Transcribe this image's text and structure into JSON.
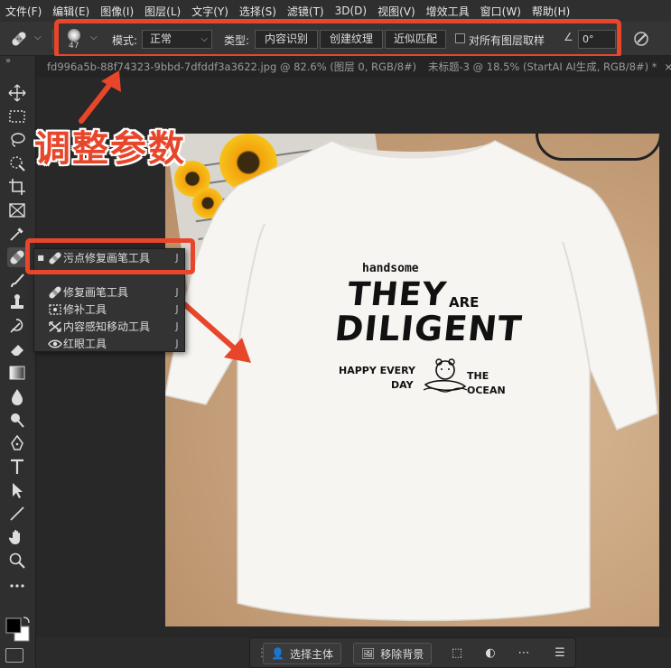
{
  "menu": [
    "文件(F)",
    "编辑(E)",
    "图像(I)",
    "图层(L)",
    "文字(Y)",
    "选择(S)",
    "滤镜(T)",
    "3D(D)",
    "视图(V)",
    "增效工具",
    "窗口(W)",
    "帮助(H)"
  ],
  "options": {
    "brush_size": "47",
    "mode_label": "模式:",
    "mode_value": "正常",
    "type_label": "类型:",
    "type_buttons": [
      "内容识别",
      "创建纹理",
      "近似匹配"
    ],
    "sample_all_label": "对所有图层取样",
    "angle_value": "0°"
  },
  "tabs": [
    {
      "title": "fd996a5b-88f74323-9bbd-7dfddf3a3622.jpg @ 82.6% (图层 0, RGB/8#) *"
    },
    {
      "title": "未标题-3 @ 18.5% (StartAI AI生成, RGB/8#) *"
    }
  ],
  "annotation": {
    "title": "调整参数",
    "accent_color": "#e8462a"
  },
  "flyout": {
    "items": [
      {
        "label": "污点修复画笔工具",
        "key": "J",
        "selected": true
      },
      {
        "label": "修复画笔工具",
        "key": "J",
        "selected": false
      },
      {
        "label": "修补工具",
        "key": "J",
        "selected": false
      },
      {
        "label": "内容感知移动工具",
        "key": "J",
        "selected": false
      },
      {
        "label": "红眼工具",
        "key": "J",
        "selected": false
      }
    ]
  },
  "shirt_print": {
    "line1": "handsome",
    "line2": "THEY",
    "line2b": "ARE",
    "line3": "DILIGENT",
    "line4a": "HAPPY EVERY",
    "line4b": "DAY",
    "line5a": "THE",
    "line5b": "OCEAN"
  },
  "bottombar": {
    "select_subject": "选择主体",
    "remove_bg": "移除背景"
  }
}
